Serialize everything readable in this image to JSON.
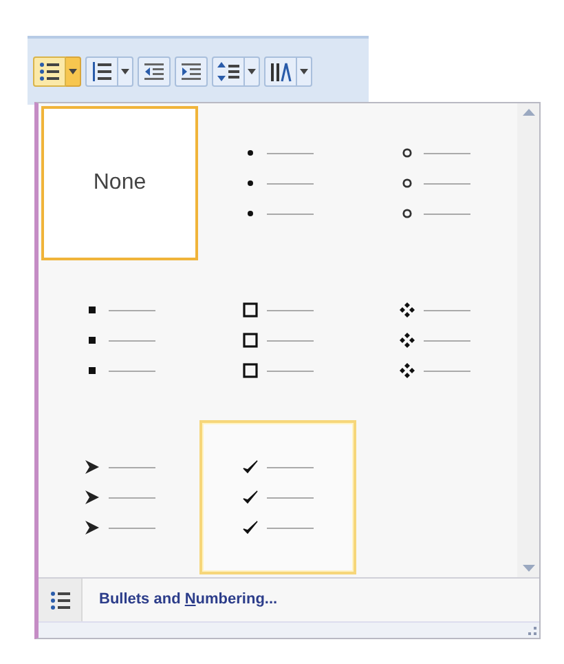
{
  "toolbar": [
    {
      "kind": "bullets",
      "pressed": true,
      "dropdown": true
    },
    {
      "kind": "numbering",
      "pressed": false,
      "dropdown": true
    },
    {
      "kind": "decrease-indent",
      "pressed": false,
      "dropdown": false
    },
    {
      "kind": "increase-indent",
      "pressed": false,
      "dropdown": false
    },
    {
      "kind": "line-spacing",
      "pressed": false,
      "dropdown": true
    },
    {
      "kind": "text-direction",
      "pressed": false,
      "dropdown": true
    }
  ],
  "bullet_library": [
    {
      "kind": "none",
      "label": "None",
      "selected": true,
      "hovered": false
    },
    {
      "kind": "dot",
      "selected": false,
      "hovered": false
    },
    {
      "kind": "circle",
      "selected": false,
      "hovered": false
    },
    {
      "kind": "square",
      "selected": false,
      "hovered": false
    },
    {
      "kind": "box",
      "selected": false,
      "hovered": false
    },
    {
      "kind": "diamonds",
      "selected": false,
      "hovered": false
    },
    {
      "kind": "arrowhead",
      "selected": false,
      "hovered": false
    },
    {
      "kind": "check",
      "selected": false,
      "hovered": true
    }
  ],
  "footer_item": {
    "before": "Bullets and ",
    "access_key": "N",
    "after": "umbering..."
  }
}
